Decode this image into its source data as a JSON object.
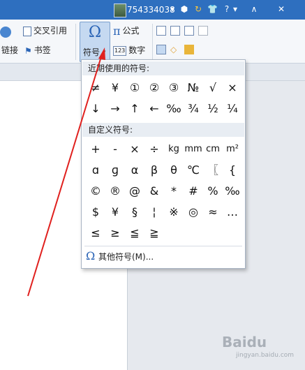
{
  "titlebar": {
    "user": "754334038",
    "icons": [
      "dropdown-arrow-icon",
      "shield-icon",
      "skin-icon",
      "shirt-icon",
      "help-icon",
      "help-dropdown-icon",
      "collapse-icon",
      "close-icon"
    ],
    "glyphs": [
      "▾",
      "⬢",
      "↻",
      "👕",
      "?",
      "▾",
      "∧",
      "✕"
    ]
  },
  "ribbon": {
    "cross_ref": "交叉引用",
    "link": "链接",
    "bookmark": "书签",
    "symbol": "符号",
    "symbol_arrow": "▾",
    "formula": "公式",
    "number": "数字",
    "pi": "π",
    "omega": "Ω",
    "numicon": "123"
  },
  "menu": {
    "recent_title": "近期使用的符号:",
    "recent_symbols": [
      "≠",
      "¥",
      "①",
      "②",
      "③",
      "№",
      "√",
      "×",
      "↓",
      "→",
      "↑",
      "←",
      "‰",
      "¾",
      "½",
      "¼"
    ],
    "custom_title": "自定义符号:",
    "custom_symbols": [
      "+",
      "-",
      "×",
      "÷",
      "kg",
      "mm",
      "cm",
      "m²",
      "ɑ",
      "ɡ",
      "α",
      "β",
      "θ",
      "℃",
      "〖",
      "{",
      "©",
      "®",
      "@",
      "&",
      "*",
      "#",
      "%",
      "‰",
      "$",
      "¥",
      "§",
      "¦",
      "※",
      "◎",
      "≈",
      "…",
      "≤",
      "≥",
      "≦",
      "≧"
    ],
    "more_omega": "Ω",
    "more_label": "其他符号(M)..."
  },
  "watermark": {
    "brand": "Baidu",
    "sub": "jingyan.baidu.com"
  },
  "colors": {
    "titlebar": "#2e6fbf",
    "accent": "#2a64b6",
    "arrow": "#e0201e"
  }
}
